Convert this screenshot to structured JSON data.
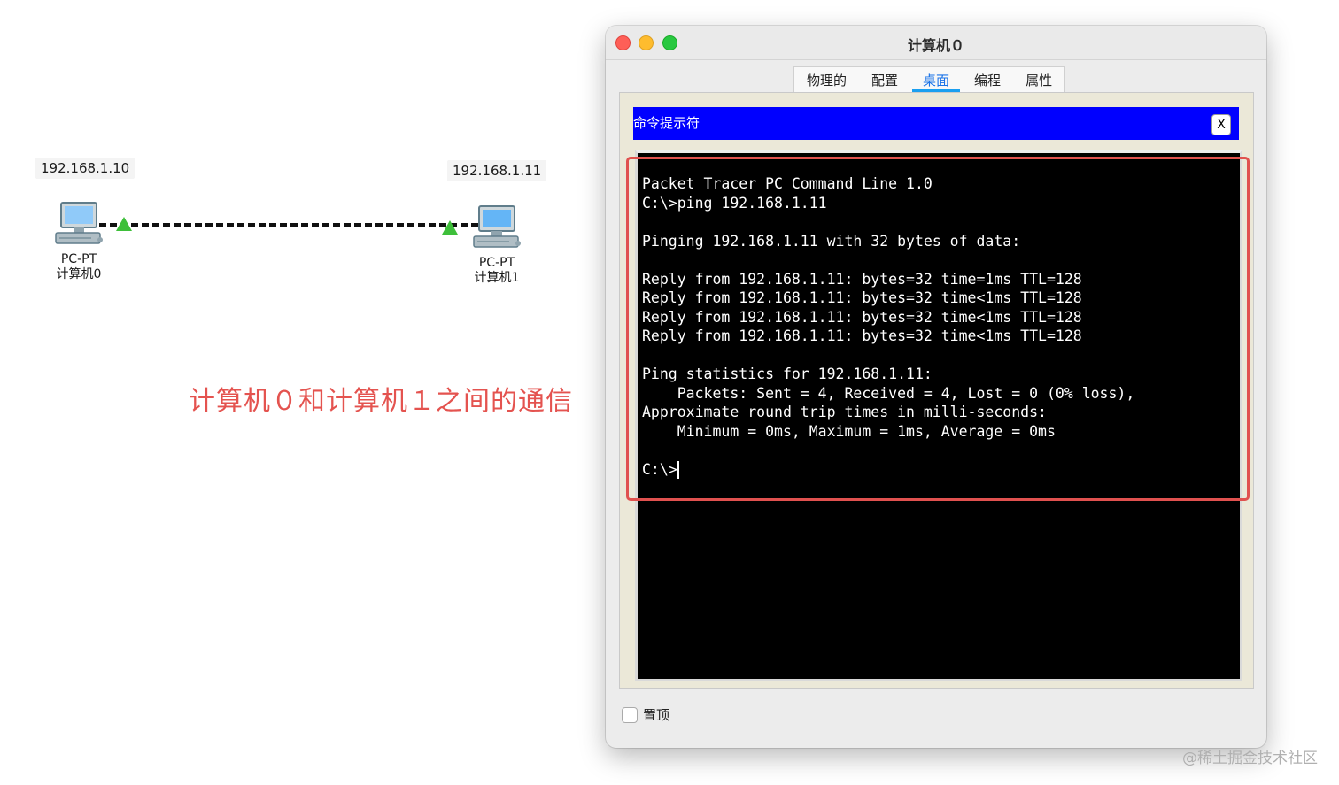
{
  "topology": {
    "pc0": {
      "ip": "192.168.1.10",
      "type": "PC-PT",
      "name": "计算机0"
    },
    "pc1": {
      "ip": "192.168.1.11",
      "type": "PC-PT",
      "name": "计算机1"
    },
    "link_status_color": "#3ebf3a"
  },
  "annotation": "计算机０和计算机１之间的通信",
  "window": {
    "title": "计算机０",
    "tabs": [
      {
        "label": "物理的"
      },
      {
        "label": "配置"
      },
      {
        "label": "桌面",
        "active": true
      },
      {
        "label": "编程"
      },
      {
        "label": "属性"
      }
    ],
    "cmd_title": "命令提示符",
    "cmd_close": "X",
    "terminal_lines": [
      "Packet Tracer PC Command Line 1.0",
      "C:\\>ping 192.168.1.11",
      "",
      "Pinging 192.168.1.11 with 32 bytes of data:",
      "",
      "Reply from 192.168.1.11: bytes=32 time=1ms TTL=128",
      "Reply from 192.168.1.11: bytes=32 time<1ms TTL=128",
      "Reply from 192.168.1.11: bytes=32 time<1ms TTL=128",
      "Reply from 192.168.1.11: bytes=32 time<1ms TTL=128",
      "",
      "Ping statistics for 192.168.1.11:",
      "    Packets: Sent = 4, Received = 4, Lost = 0 (0% loss),",
      "Approximate round trip times in milli-seconds:",
      "    Minimum = 0ms, Maximum = 1ms, Average = 0ms",
      ""
    ],
    "prompt": "C:\\>",
    "always_on_top_label": "置顶",
    "always_on_top_checked": false
  },
  "watermark": "@稀土掘金技术社区"
}
